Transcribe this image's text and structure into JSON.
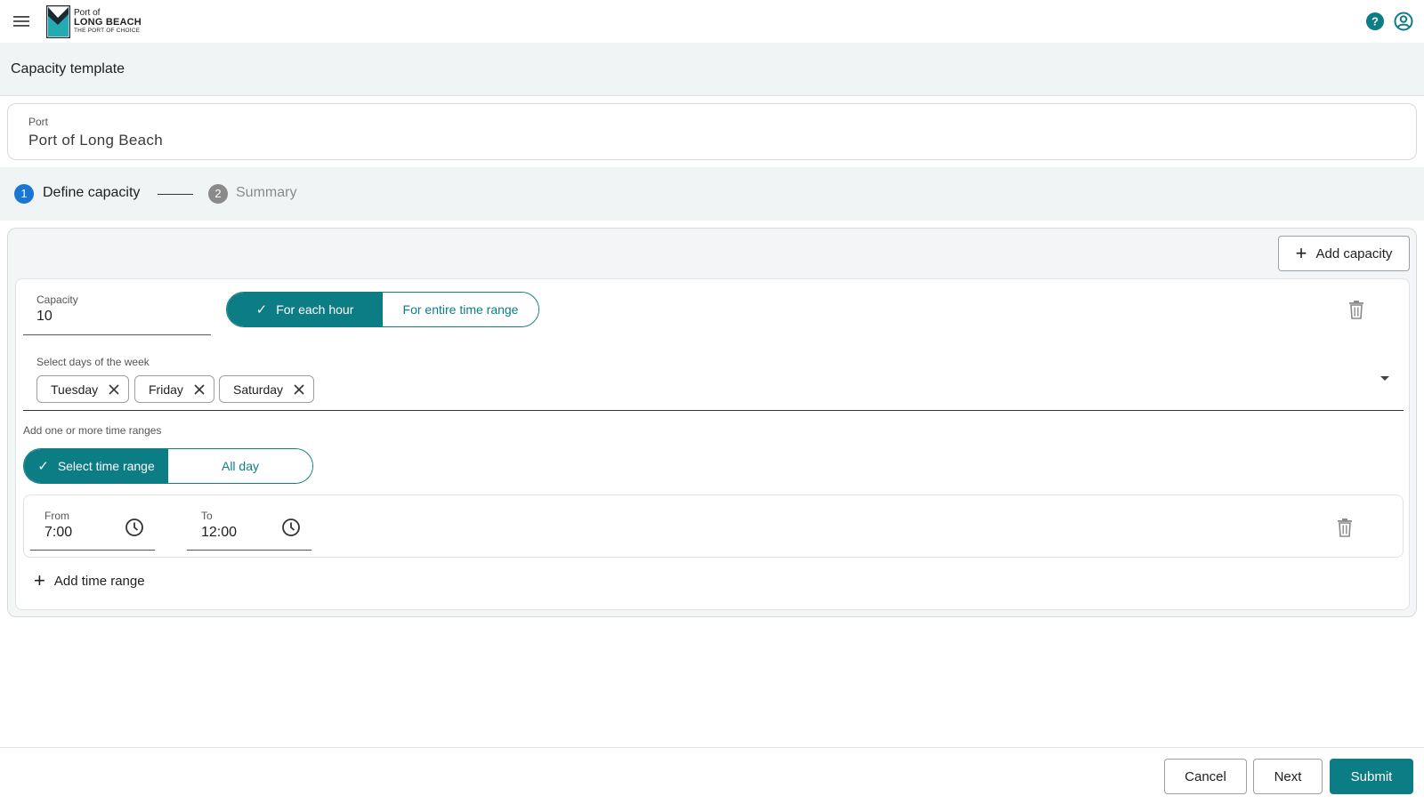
{
  "header": {
    "logo_line1": "Port of",
    "logo_line2": "LONG BEACH",
    "logo_line3": "THE PORT OF CHOICE",
    "accent_color": "#0c7d84"
  },
  "page": {
    "title": "Capacity template"
  },
  "port_field": {
    "label": "Port",
    "value": "Port of Long Beach"
  },
  "stepper": {
    "steps": [
      {
        "number": "1",
        "label": "Define capacity",
        "state": "active"
      },
      {
        "number": "2",
        "label": "Summary",
        "state": "inactive"
      }
    ]
  },
  "capacity_panel": {
    "add_capacity_label": "Add capacity",
    "capacity": {
      "label": "Capacity",
      "value": "10"
    },
    "mode_toggle": {
      "options": [
        {
          "label": "For each hour",
          "selected": true
        },
        {
          "label": "For entire time range",
          "selected": false
        }
      ]
    },
    "days": {
      "label": "Select days of the week",
      "selected": [
        "Tuesday",
        "Friday",
        "Saturday"
      ]
    },
    "ranges_label": "Add one or more time ranges",
    "range_toggle": {
      "options": [
        {
          "label": "Select time range",
          "selected": true
        },
        {
          "label": "All day",
          "selected": false
        }
      ]
    },
    "time_range": {
      "from": {
        "label": "From",
        "value": "7:00"
      },
      "to": {
        "label": "To",
        "value": "12:00"
      }
    },
    "add_time_range_label": "Add time range"
  },
  "footer": {
    "cancel_label": "Cancel",
    "next_label": "Next",
    "submit_label": "Submit"
  }
}
